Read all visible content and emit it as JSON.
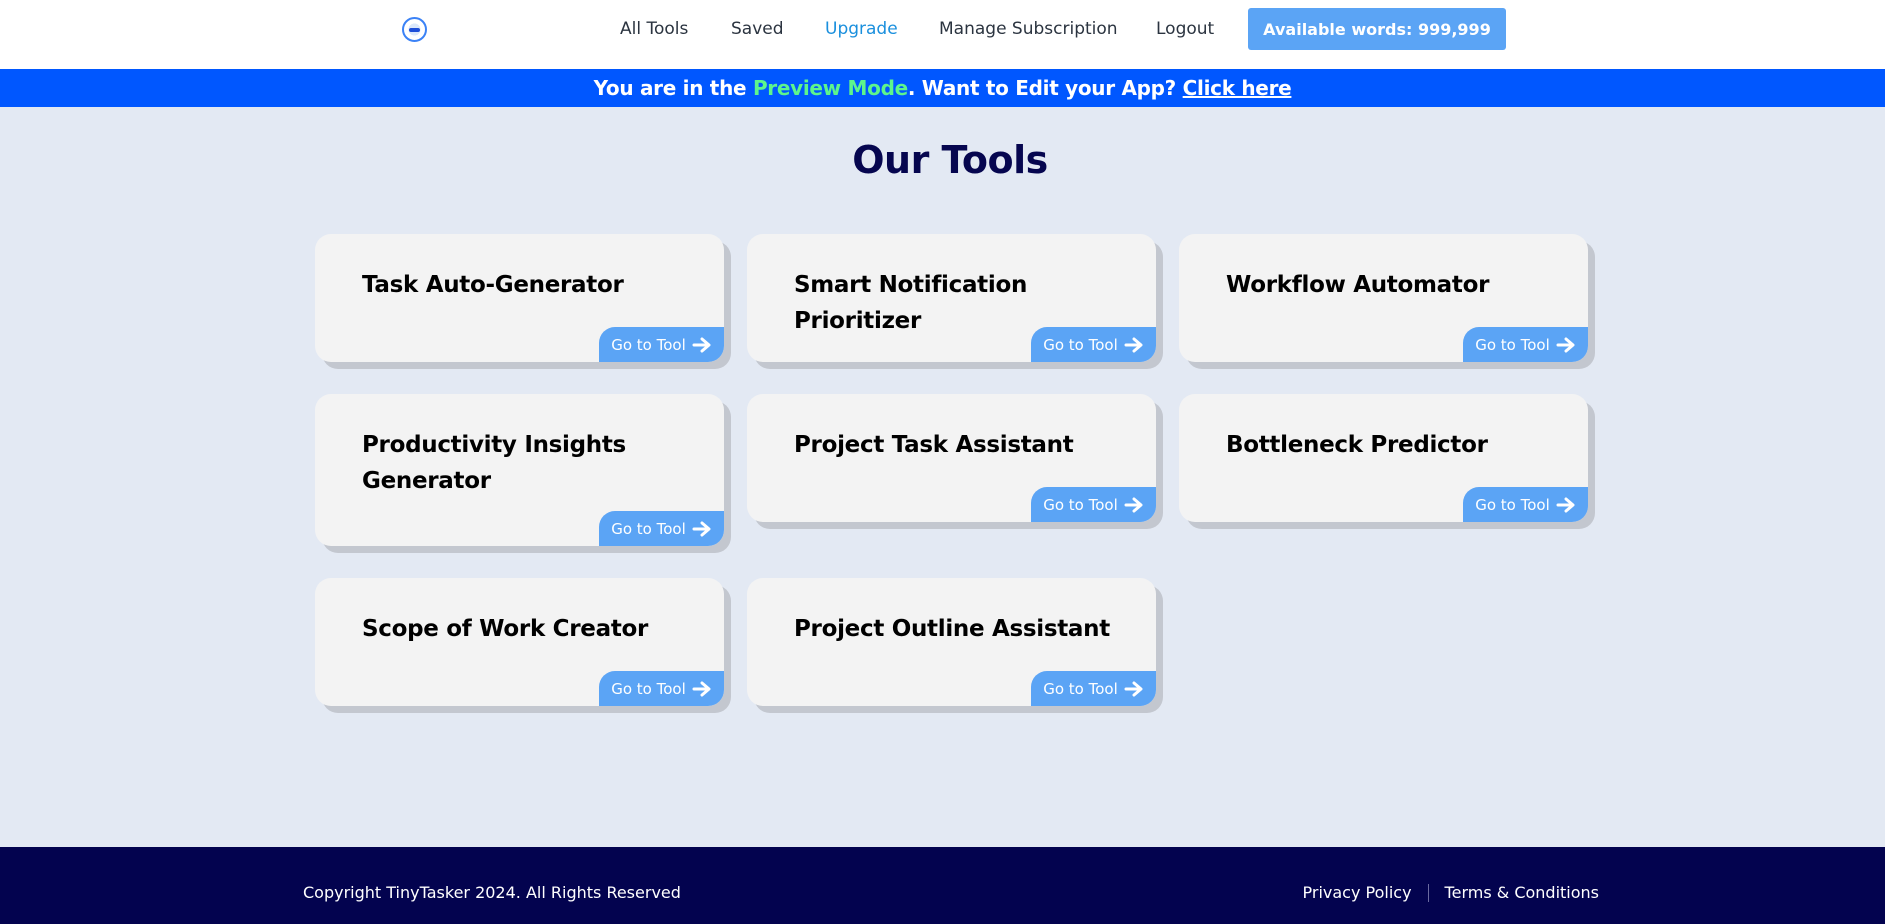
{
  "header": {
    "logo_icon": "circular-logo-icon",
    "nav": [
      {
        "label": "All Tools",
        "active": false
      },
      {
        "label": "Saved",
        "active": false
      },
      {
        "label": "Upgrade",
        "active": true
      },
      {
        "label": "Manage Subscription",
        "active": false
      },
      {
        "label": "Logout",
        "active": false
      }
    ],
    "words_button": "Available words: 999,999"
  },
  "banner": {
    "prefix": "You are in the ",
    "mode": "Preview Mode",
    "middle": ". Want to Edit your App? ",
    "link": "Click here"
  },
  "main": {
    "title": "Our Tools",
    "tools": [
      {
        "name": "Task Auto-Generator",
        "button": "Go to Tool"
      },
      {
        "name": "Smart Notification Prioritizer",
        "button": "Go to Tool"
      },
      {
        "name": "Workflow Automator",
        "button": "Go to Tool"
      },
      {
        "name": "Productivity Insights Generator",
        "button": "Go to Tool"
      },
      {
        "name": "Project Task Assistant",
        "button": "Go to Tool"
      },
      {
        "name": "Bottleneck Predictor",
        "button": "Go to Tool"
      },
      {
        "name": "Scope of Work Creator",
        "button": "Go to Tool"
      },
      {
        "name": "Project Outline Assistant",
        "button": "Go to Tool"
      }
    ]
  },
  "footer": {
    "copyright": "Copyright TinyTasker 2024. All Rights Reserved",
    "links": [
      "Privacy Policy",
      "Terms & Conditions"
    ]
  },
  "colors": {
    "banner_bg": "#0057ff",
    "preview_mode": "#5df58c",
    "button": "#5ba4f5",
    "footer_bg": "#03034f",
    "page_bg": "#e3e9f3",
    "active_nav": "#1a8fdd"
  }
}
